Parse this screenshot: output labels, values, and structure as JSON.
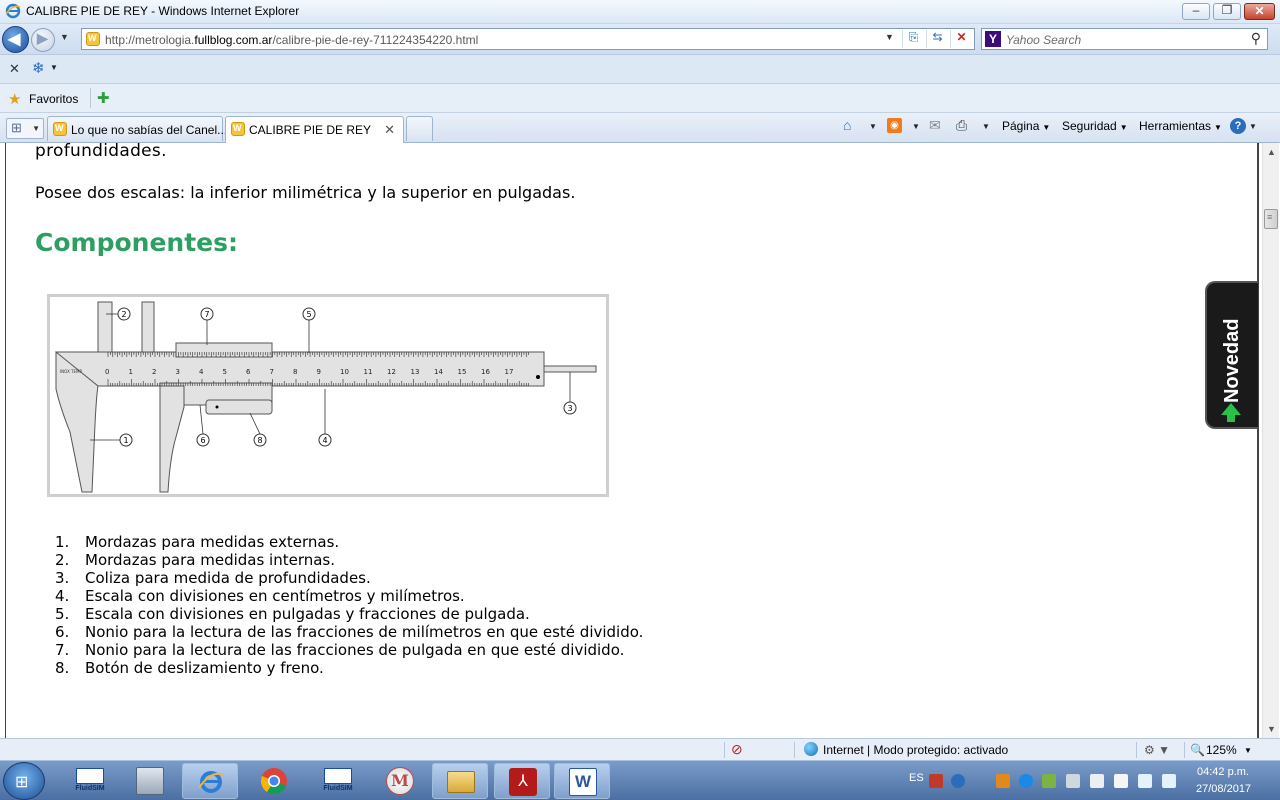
{
  "window": {
    "title": "CALIBRE PIE DE REY - Windows Internet Explorer"
  },
  "address": {
    "url_prefix": "http://metrologia.",
    "url_domain": "fullblog.com.ar",
    "url_suffix": "/calibre-pie-de-rey-711224354220.html",
    "search_placeholder": "Yahoo Search"
  },
  "favorites": {
    "label": "Favoritos"
  },
  "tabs": [
    {
      "label": "Lo que no sabías del Canel..."
    },
    {
      "label": "CALIBRE PIE DE REY"
    }
  ],
  "commands": {
    "page": "Página",
    "safety": "Seguridad",
    "tools": "Herramientas"
  },
  "content": {
    "prev_line": "profundidades.",
    "paragraph": "Posee dos escalas: la inferior milimétrica y la superior en pulgadas.",
    "heading": "Componentes:",
    "list": [
      {
        "num": "1.",
        "text": "Mordazas para medidas externas."
      },
      {
        "num": "2.",
        "text": "Mordazas para medidas internas."
      },
      {
        "num": "3.",
        "text": "Coliza para medida de profundidades."
      },
      {
        "num": "4.",
        "text": "Escala con divisiones en centímetros y milímetros."
      },
      {
        "num": "5.",
        "text": "Escala con divisiones en pulgadas y fracciones de pulgada."
      },
      {
        "num": "6.",
        "text": "Nonio para la lectura de las fracciones de milímetros en que esté dividido."
      },
      {
        "num": "7.",
        "text": "Nonio para la lectura de las fracciones de pulgada en que esté dividido."
      },
      {
        "num": "8.",
        "text": "Botón de deslizamiento y freno."
      }
    ],
    "figure_callouts": [
      "1",
      "2",
      "3",
      "4",
      "5",
      "6",
      "7",
      "8"
    ],
    "figure_scale": [
      "0",
      "1",
      "2",
      "3",
      "4",
      "5",
      "6",
      "7",
      "8",
      "9",
      "10",
      "11",
      "12",
      "13",
      "14",
      "15",
      "16",
      "17"
    ],
    "side_badge": "Novedad"
  },
  "status": {
    "zone": "Internet | Modo protegido: activado",
    "zoom": "125%"
  },
  "taskbar": {
    "apps": [
      {
        "name": "FluidSIM"
      },
      {
        "name": "FluidSIM"
      }
    ],
    "lang": "ES",
    "time": "04:42 p.m.",
    "date": "27/08/2017"
  },
  "colors": {
    "heading": "#2f9e63",
    "badge_bg": "#1a1a1a",
    "badge_arrow": "#28c24a"
  }
}
